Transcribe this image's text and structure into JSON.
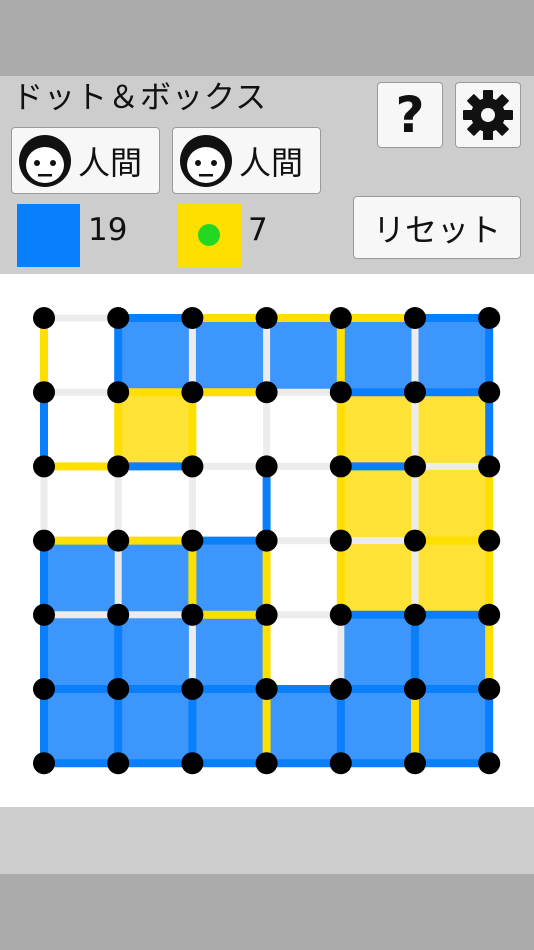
{
  "app": {
    "title": "ドット＆ボックス"
  },
  "toolbar": {
    "help_label": "?",
    "settings_icon": "gear-icon"
  },
  "players": [
    {
      "label": "人間",
      "icon": "human-face-icon",
      "color": "#0a7ffb",
      "score": "19"
    },
    {
      "label": "人間",
      "icon": "human-face-icon",
      "color": "#ffdf00",
      "score": "7",
      "active": true
    }
  ],
  "controls": {
    "reset_label": "リセット"
  },
  "colors": {
    "blue": "#0a7ffb",
    "yellow": "#ffdf00",
    "fill_blue": "#3c96fb",
    "fill_yellow": "#ffe236",
    "empty_line": "#ececec",
    "dot": "#000000",
    "turn_indicator": "#22d822"
  },
  "board": {
    "dots_per_side": 7,
    "hlines": [
      [
        "E",
        "B",
        "Y",
        "Y",
        "Y",
        "B"
      ],
      [
        "E",
        "Y",
        "Y",
        "E",
        "B",
        "B"
      ],
      [
        "Y",
        "B",
        "E",
        "E",
        "B",
        "E"
      ],
      [
        "Y",
        "Y",
        "B",
        "E",
        "E",
        "Y"
      ],
      [
        "E",
        "E",
        "Y",
        "E",
        "B",
        "B"
      ],
      [
        "B",
        "B",
        "B",
        "B",
        "B",
        "B"
      ],
      [
        "B",
        "B",
        "B",
        "B",
        "B",
        "B"
      ]
    ],
    "vlines": [
      [
        "Y",
        "B",
        "E",
        "E",
        "Y",
        "E",
        "B"
      ],
      [
        "B",
        "Y",
        "Y",
        "E",
        "Y",
        "E",
        "B"
      ],
      [
        "E",
        "E",
        "E",
        "B",
        "Y",
        "E",
        "Y"
      ],
      [
        "B",
        "E",
        "Y",
        "Y",
        "Y",
        "E",
        "Y"
      ],
      [
        "B",
        "B",
        "E",
        "Y",
        "E",
        "B",
        "Y"
      ],
      [
        "B",
        "B",
        "B",
        "Y",
        "B",
        "Y",
        "B"
      ]
    ],
    "boxes": [
      [
        "E",
        "B",
        "B",
        "B",
        "B",
        "B"
      ],
      [
        "E",
        "Y",
        "E",
        "E",
        "Y",
        "Y"
      ],
      [
        "E",
        "E",
        "E",
        "E",
        "Y",
        "Y"
      ],
      [
        "B",
        "B",
        "B",
        "E",
        "Y",
        "Y"
      ],
      [
        "B",
        "B",
        "B",
        "E",
        "B",
        "B"
      ],
      [
        "B",
        "B",
        "B",
        "B",
        "B",
        "B"
      ]
    ]
  }
}
